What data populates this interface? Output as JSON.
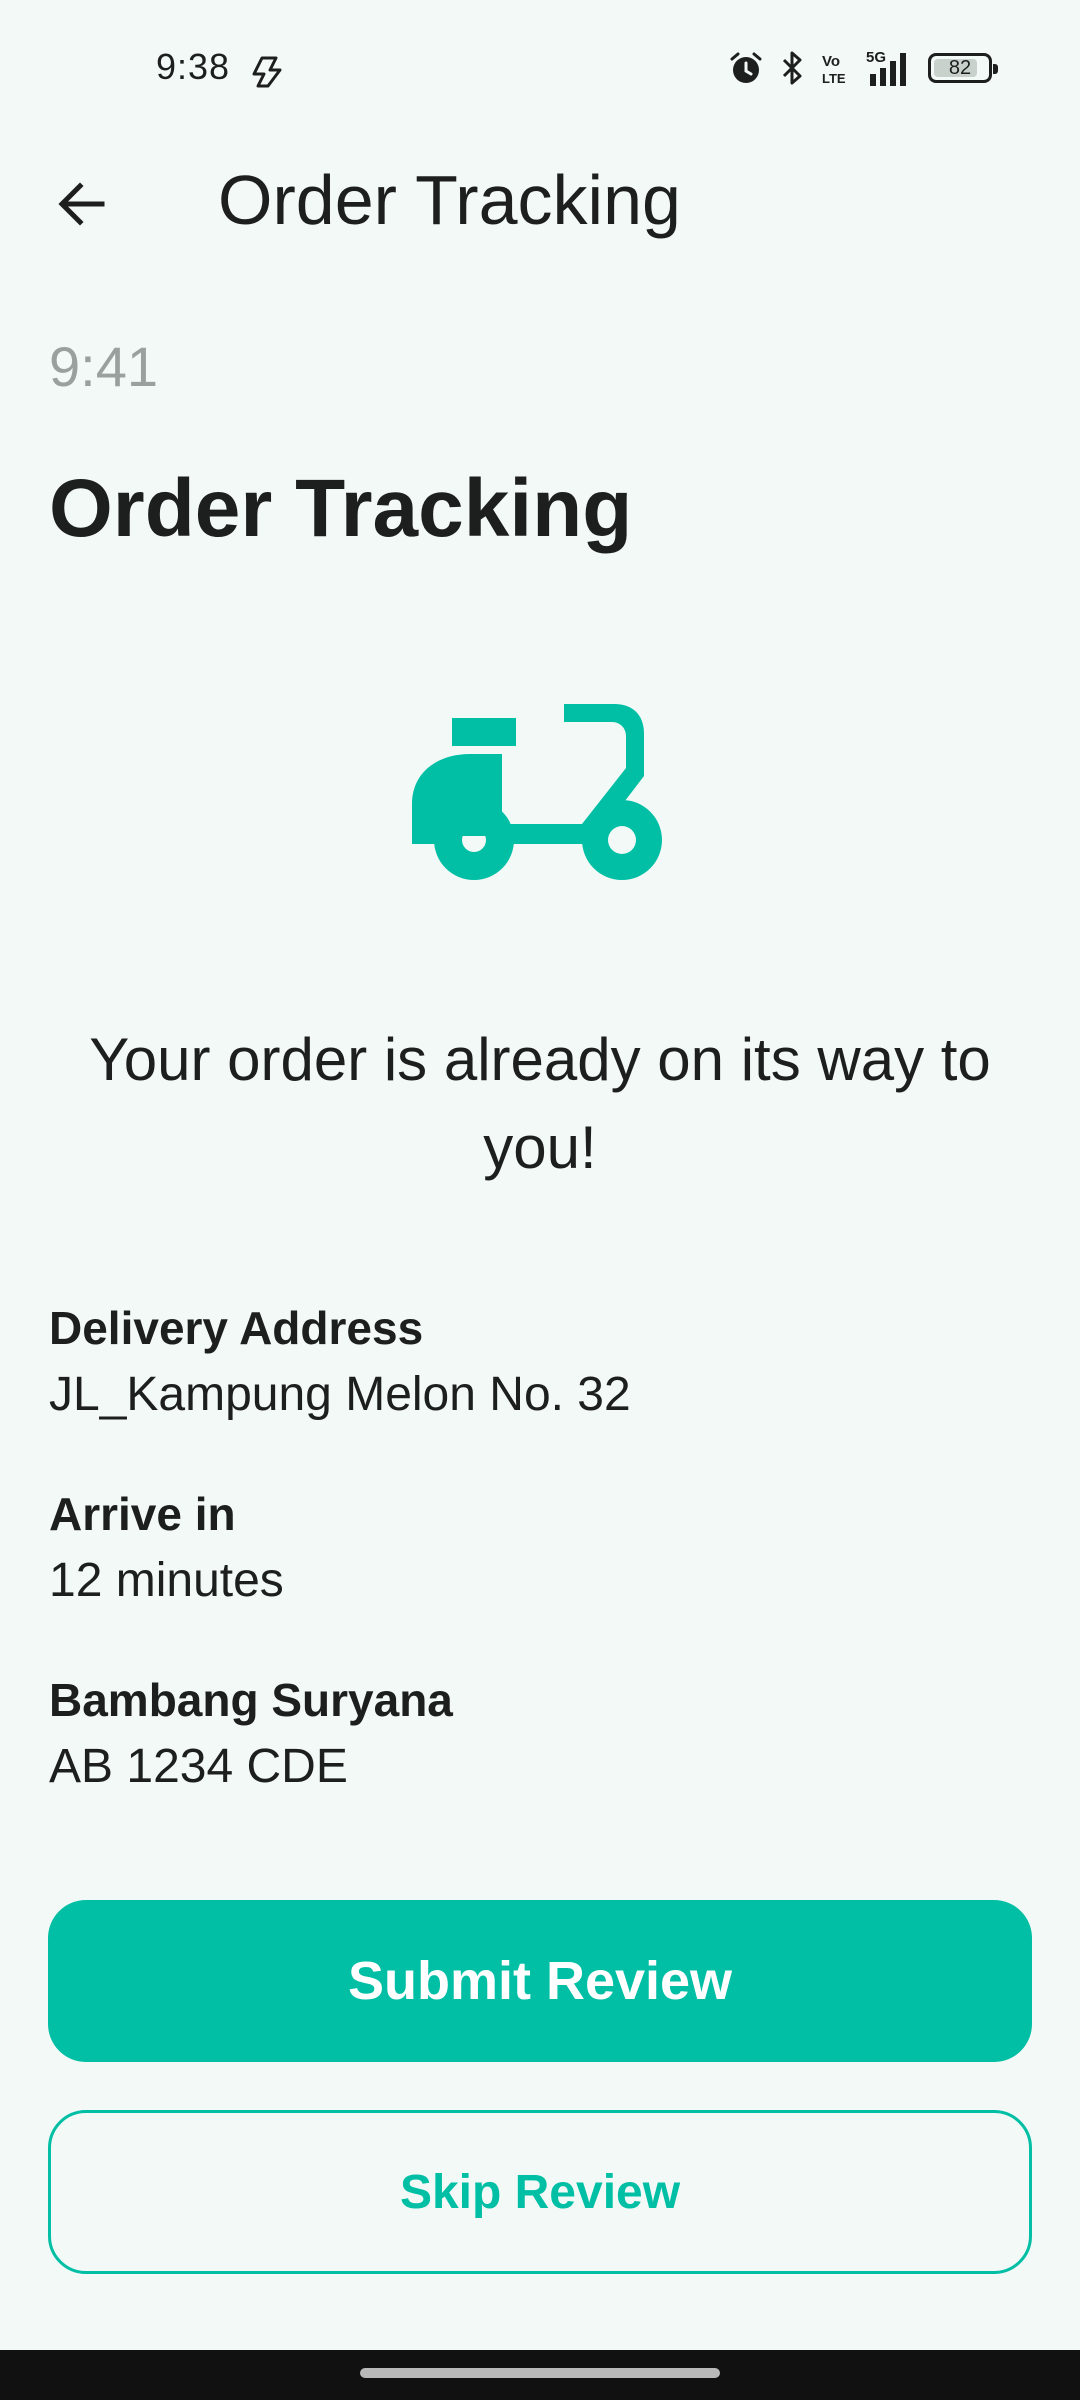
{
  "status_bar": {
    "time": "9:38",
    "left_icon": "copilot-icon",
    "right_icons": [
      "alarm-icon",
      "bluetooth-icon",
      "volte-icon",
      "5g-signal-icon"
    ],
    "network_label_top": "Vo",
    "network_label_bottom": "LTE",
    "network_type": "5G",
    "battery_level": "82",
    "battery_fraction": 0.82
  },
  "app_bar": {
    "back_icon": "arrow-left-icon",
    "title": "Order Tracking"
  },
  "content": {
    "time": "9:41",
    "heading": "Order Tracking",
    "illustration": "scooter-icon",
    "message": "Your order is already on its way to you!",
    "delivery_address_label": "Delivery Address",
    "delivery_address_value": "JL_Kampung Melon No. 32",
    "arrive_label": "Arrive in",
    "arrive_value": "12 minutes",
    "courier_name": "Bambang Suryana",
    "courier_plate": "AB 1234 CDE"
  },
  "actions": {
    "submit_label": "Submit Review",
    "skip_label": "Skip Review"
  },
  "colors": {
    "accent": "#00bfa5",
    "background": "#f3f9f6",
    "text": "#1c1f1e",
    "muted": "#9aa09e"
  }
}
